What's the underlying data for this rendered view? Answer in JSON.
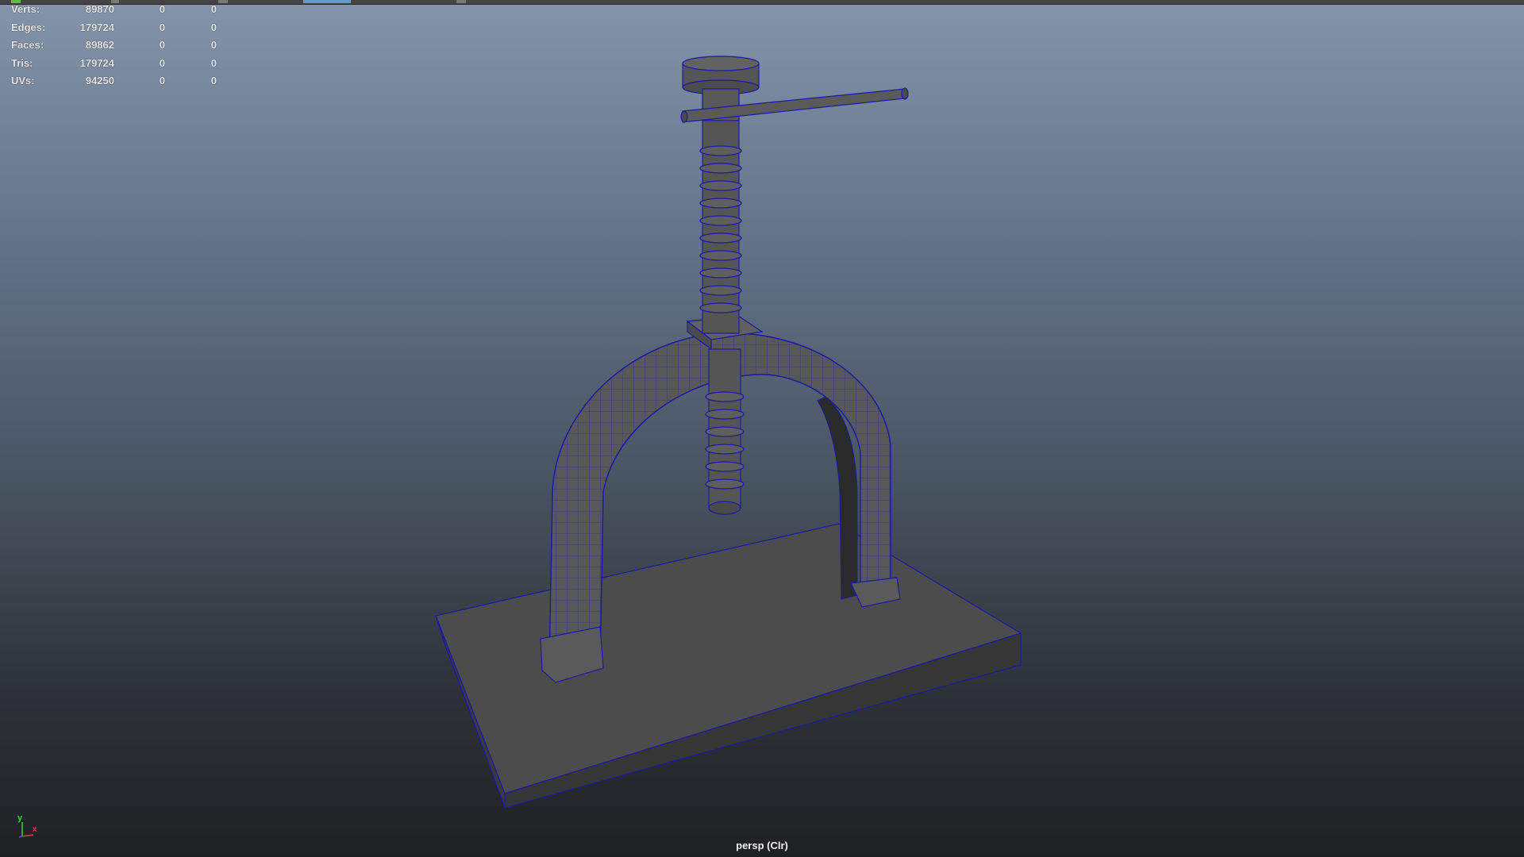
{
  "hud": {
    "rows": [
      {
        "label": "Verts:",
        "total": "89870",
        "selected": "0",
        "component": "0"
      },
      {
        "label": "Edges:",
        "total": "179724",
        "selected": "0",
        "component": "0"
      },
      {
        "label": "Faces:",
        "total": "89862",
        "selected": "0",
        "component": "0"
      },
      {
        "label": "Tris:",
        "total": "179724",
        "selected": "0",
        "component": "0"
      },
      {
        "label": "UVs:",
        "total": "94250",
        "selected": "0",
        "component": "0"
      }
    ]
  },
  "viewport": {
    "camera_label": "persp (Clr)"
  },
  "axis_gizmo": {
    "y_label": "y",
    "x_label": "x"
  },
  "colors": {
    "wireframe": "#1a1aa8",
    "mesh_face": "#5a5a5a",
    "mesh_face_dark": "#404040",
    "background_top": "#8494aa",
    "background_bottom": "#1e2124"
  }
}
